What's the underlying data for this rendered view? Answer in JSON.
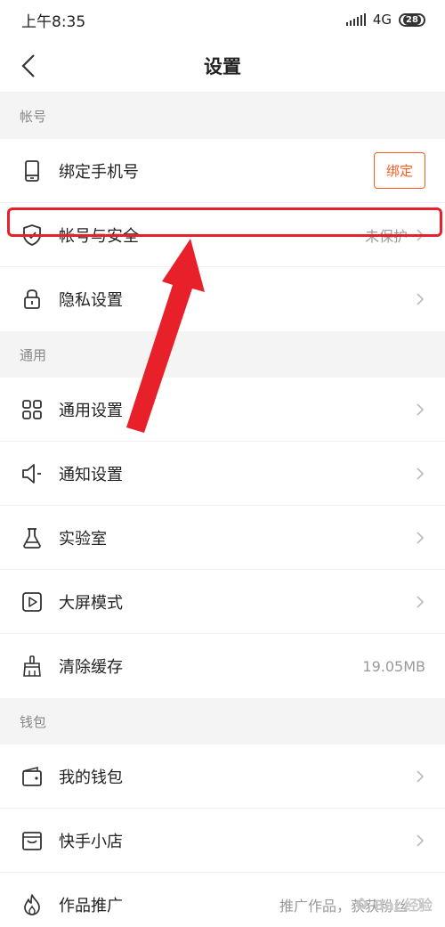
{
  "status": {
    "time": "上午8:35",
    "network": "4G",
    "battery": "28"
  },
  "nav": {
    "title": "设置"
  },
  "sections": {
    "account": {
      "header": "帐号"
    },
    "general": {
      "header": "通用"
    },
    "wallet": {
      "header": "钱包"
    }
  },
  "rows": {
    "bind_phone": {
      "label": "绑定手机号",
      "button": "绑定"
    },
    "account_security": {
      "label": "帐号与安全",
      "value": "未保护"
    },
    "privacy": {
      "label": "隐私设置"
    },
    "general_settings": {
      "label": "通用设置"
    },
    "notification": {
      "label": "通知设置"
    },
    "lab": {
      "label": "实验室"
    },
    "big_screen": {
      "label": "大屏模式"
    },
    "clear_cache": {
      "label": "清除缓存",
      "value": "19.05MB"
    },
    "my_wallet": {
      "label": "我的钱包"
    },
    "shop": {
      "label": "快手小店"
    },
    "promotion": {
      "label": "作品推广",
      "value": "推广作品，获获粉丝"
    }
  },
  "watermark": {
    "text": "Bai 经验"
  },
  "colors": {
    "accent": "#ff5a1f",
    "highlight": "#e8202a"
  }
}
